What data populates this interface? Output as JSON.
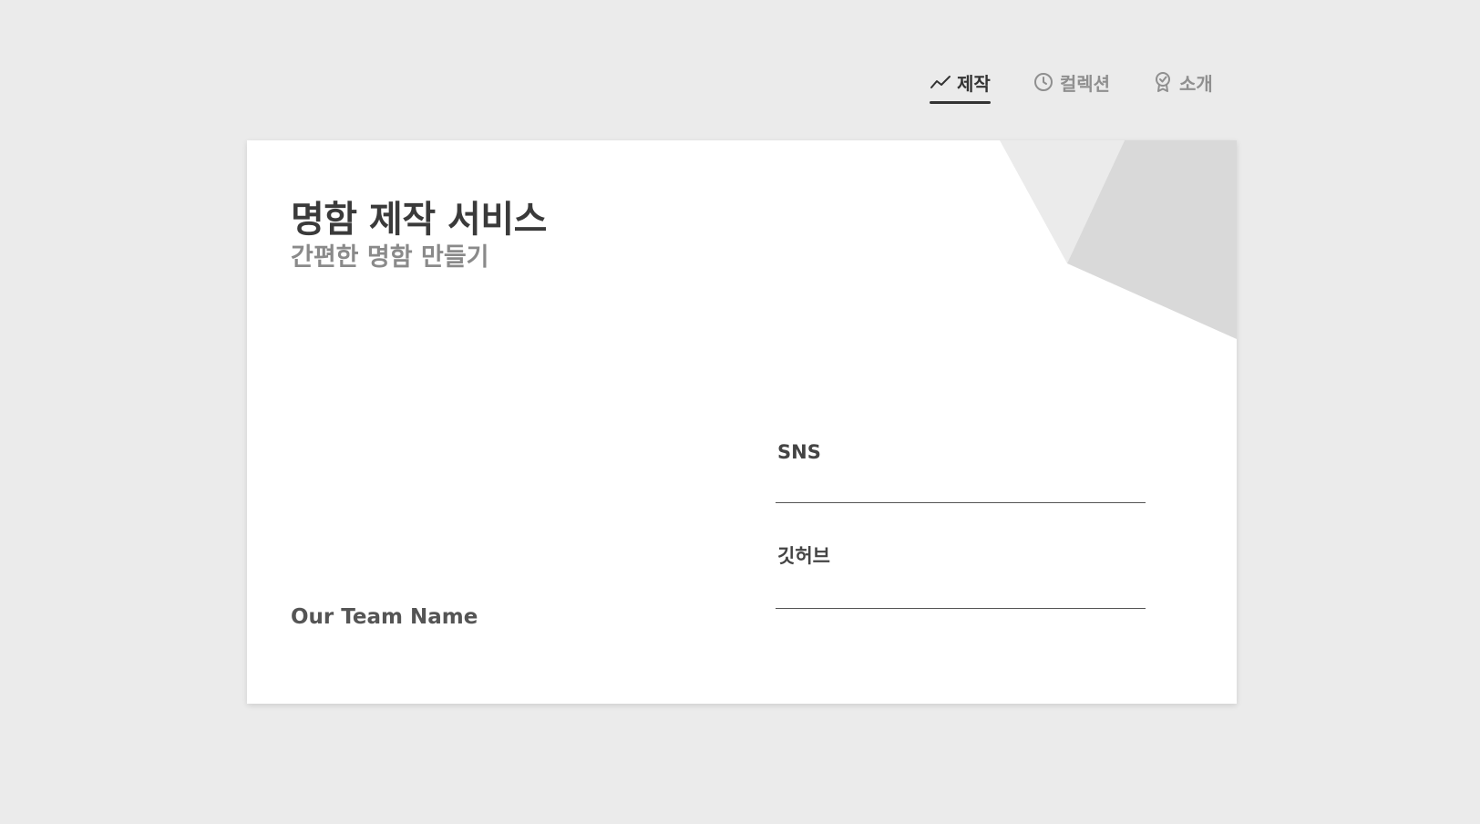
{
  "nav": {
    "items": [
      {
        "label": "제작",
        "icon": "trend-line-icon",
        "active": true
      },
      {
        "label": "컬렉션",
        "icon": "clock-icon",
        "active": false
      },
      {
        "label": "소개",
        "icon": "award-badge-icon",
        "active": false
      }
    ]
  },
  "card": {
    "title": "명함 제작 서비스",
    "subtitle": "간편한 명함 만들기",
    "team_name": "Our Team Name",
    "fields": {
      "sns": {
        "label": "SNS",
        "value": ""
      },
      "github": {
        "label": "깃허브",
        "value": ""
      }
    },
    "decoration_colors": [
      "#ebebeb",
      "#d9d9d9"
    ]
  }
}
